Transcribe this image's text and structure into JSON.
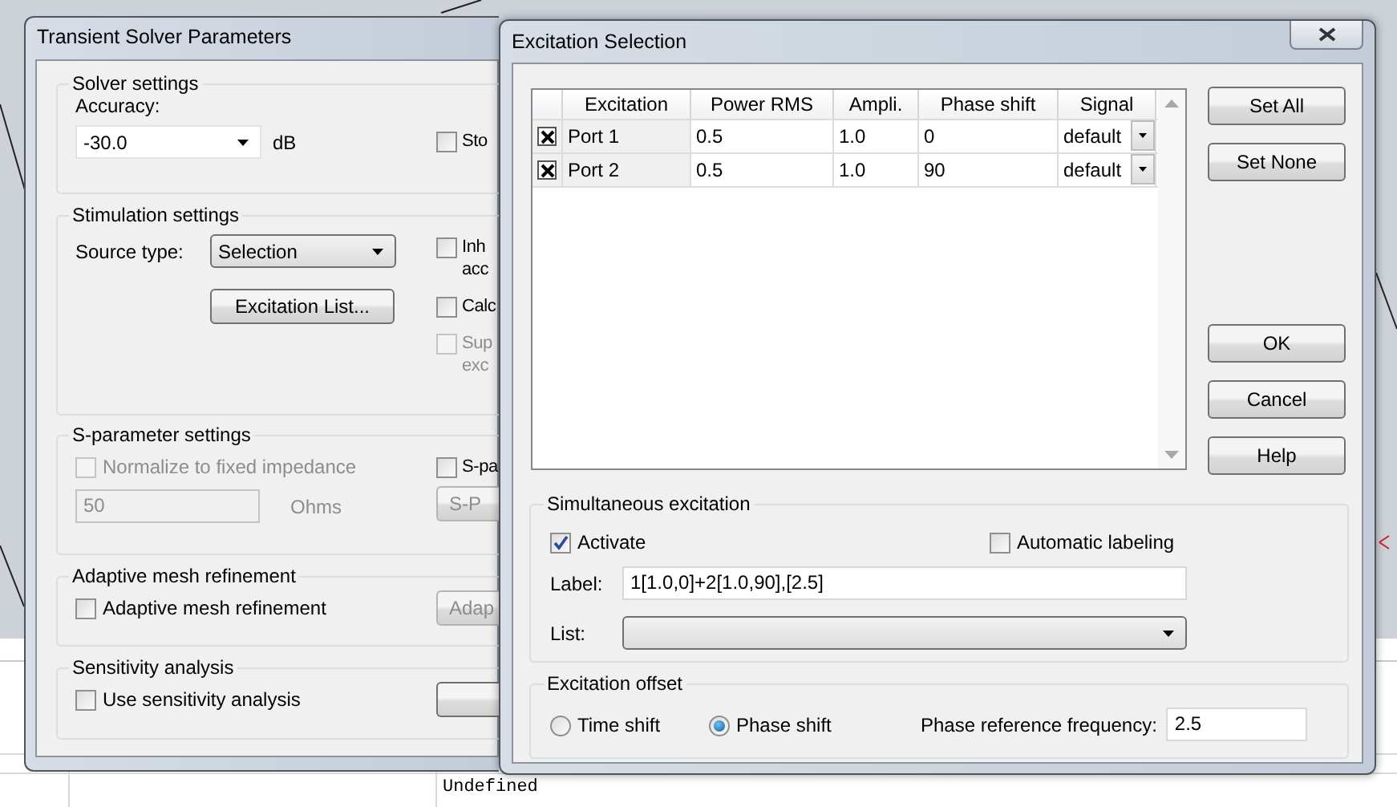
{
  "solver_window": {
    "title": "Transient Solver Parameters",
    "solver_settings": {
      "title": "Solver settings",
      "accuracy_label": "Accuracy:",
      "accuracy": "-30.0",
      "accuracy_unit": "dB",
      "option": {
        "lines": [
          "Sto"
        ],
        "checked": false,
        "disabled": false
      }
    },
    "stimulation_settings": {
      "title": "Stimulation settings",
      "source_type_label": "Source type:",
      "source_type": "Selection",
      "excitation_list_button": "Excitation List...",
      "options": [
        {
          "lines": [
            "Inh",
            "acc"
          ],
          "checked": false,
          "disabled": false
        },
        {
          "lines": [
            "Calc"
          ],
          "checked": false,
          "disabled": false
        },
        {
          "lines": [
            "Sup",
            "exc"
          ],
          "checked": false,
          "disabled": true
        }
      ]
    },
    "s_parameter_settings": {
      "title": "S-parameter settings",
      "normalize": {
        "label": "Normalize to fixed impedance",
        "checked": false,
        "disabled": true
      },
      "impedance": "50",
      "impedance_unit": "Ohms",
      "option": {
        "lines": [
          "S-pa"
        ],
        "checked": false,
        "disabled": false
      },
      "button": {
        "label": "S-P",
        "disabled": true
      }
    },
    "adaptive_mesh_refinement": {
      "title": "Adaptive mesh refinement",
      "option": {
        "label": "Adaptive mesh refinement",
        "checked": false,
        "disabled": false
      },
      "button": {
        "label": "Adap",
        "disabled": true
      }
    },
    "sensitivity_analysis": {
      "title": "Sensitivity analysis",
      "option": {
        "label": "Use sensitivity analysis",
        "checked": false,
        "disabled": false
      }
    }
  },
  "excitation_window": {
    "title": "Excitation Selection",
    "table": {
      "columns": [
        "Excitation",
        "Power RMS",
        "Ampli.",
        "Phase shift",
        "Signal"
      ],
      "rows": [
        {
          "checked": true,
          "cells": [
            "Port 1",
            "0.5",
            "1.0",
            "0"
          ],
          "signal": "default"
        },
        {
          "checked": true,
          "cells": [
            "Port 2",
            "0.5",
            "1.0",
            "90"
          ],
          "signal": "default"
        }
      ]
    },
    "side_buttons": [
      "Set All",
      "Set None"
    ],
    "dialog_buttons": [
      "OK",
      "Cancel",
      "Help"
    ],
    "simultaneous_excitation": {
      "title": "Simultaneous excitation",
      "activate": {
        "label": "Activate",
        "checked": true
      },
      "automatic_labeling": {
        "label": "Automatic labeling",
        "checked": false
      },
      "label_label": "Label:",
      "label_value": "1[1.0,0]+2[1.0,90],[2.5]",
      "list_label": "List:"
    },
    "excitation_offset": {
      "title": "Excitation offset",
      "modes": [
        {
          "label": "Time shift",
          "selected": false
        },
        {
          "label": "Phase shift",
          "selected": true
        }
      ],
      "frequency_label": "Phase reference frequency:",
      "frequency": "2.5"
    }
  },
  "background_cell": "Undefined"
}
